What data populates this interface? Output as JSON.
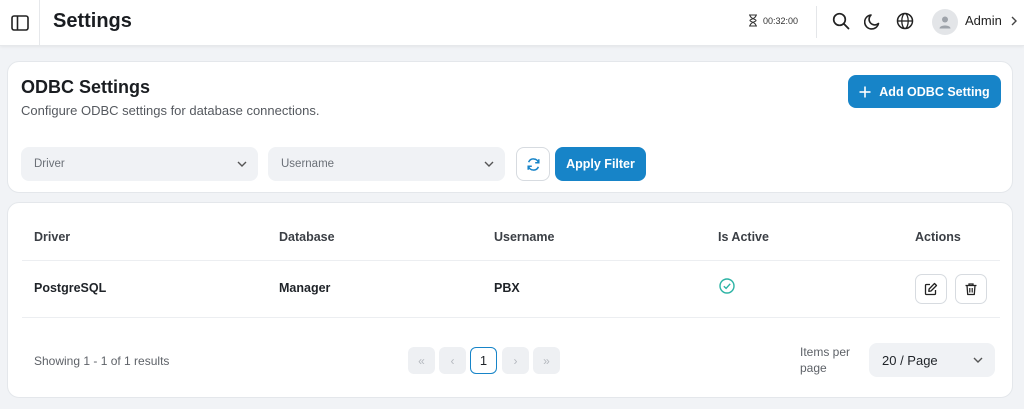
{
  "header": {
    "title": "Settings",
    "timer": "00:32:00",
    "user_name": "Admin",
    "icons": [
      "sidebar-toggle-icon",
      "hourglass-icon",
      "search-icon",
      "moon-icon",
      "globe-icon",
      "user-icon",
      "chevron-right-icon"
    ]
  },
  "odbc": {
    "title": "ODBC Settings",
    "subtitle": "Configure ODBC settings for database connections.",
    "add_button": "Add ODBC Setting",
    "filters": {
      "driver_placeholder": "Driver",
      "username_placeholder": "Username",
      "apply_button": "Apply Filter"
    }
  },
  "table": {
    "columns": {
      "driver": "Driver",
      "database": "Database",
      "username": "Username",
      "is_active": "Is Active",
      "actions": "Actions"
    },
    "rows": [
      {
        "driver": "PostgreSQL",
        "database": "Manager",
        "username": "PBX",
        "is_active": true
      }
    ]
  },
  "pagination": {
    "results_text": "Showing 1 - 1 of 1 results",
    "current_page": "1",
    "first": "«",
    "prev": "‹",
    "next": "›",
    "last": "»",
    "items_per_page_label": "Items per page",
    "page_size": "20 / Page"
  },
  "colors": {
    "primary": "#1784c8",
    "active_check": "#2bb3a4"
  }
}
